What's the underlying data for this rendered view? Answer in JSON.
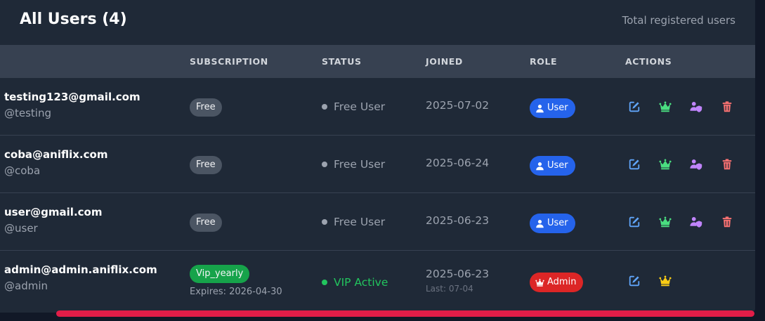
{
  "header": {
    "title": "All Users (4)",
    "subtitle": "Total registered users"
  },
  "columns": [
    "SUBSCRIPTION",
    "STATUS",
    "JOINED",
    "ROLE",
    "ACTIONS"
  ],
  "users": [
    {
      "email": "testing123@gmail.com",
      "username": "@testing",
      "subscription": "Free",
      "status": "Free User",
      "joined": "2025-07-02",
      "role": "User"
    },
    {
      "email": "coba@aniflix.com",
      "username": "@coba",
      "subscription": "Free",
      "status": "Free User",
      "joined": "2025-06-24",
      "role": "User"
    },
    {
      "email": "user@gmail.com",
      "username": "@user",
      "subscription": "Free",
      "status": "Free User",
      "joined": "2025-06-23",
      "role": "User"
    },
    {
      "email": "admin@admin.aniflix.com",
      "username": "@admin",
      "subscription": "Vip_yearly",
      "expires": "Expires: 2026-04-30",
      "status": "VIP Active",
      "joined": "2025-06-23",
      "last": "Last: 07-04",
      "role": "Admin"
    }
  ],
  "icons": {
    "edit": "edit-icon",
    "crown": "crown-icon",
    "user_shield": "user-shield-icon",
    "delete": "trash-icon",
    "user": "user-icon"
  },
  "colors": {
    "background": "#1f2937",
    "header_row": "#374151",
    "user_badge": "#2563eb",
    "admin_badge": "#dc2626",
    "vip_green": "#16a34a",
    "free_badge": "#4b5563",
    "edit_icon": "#60a5fa",
    "crown_icon": "#4ade80",
    "crown_icon_active": "#facc15",
    "shield_icon": "#c084fc",
    "delete_icon": "#f87171",
    "scrollbar": "#e11d48"
  }
}
